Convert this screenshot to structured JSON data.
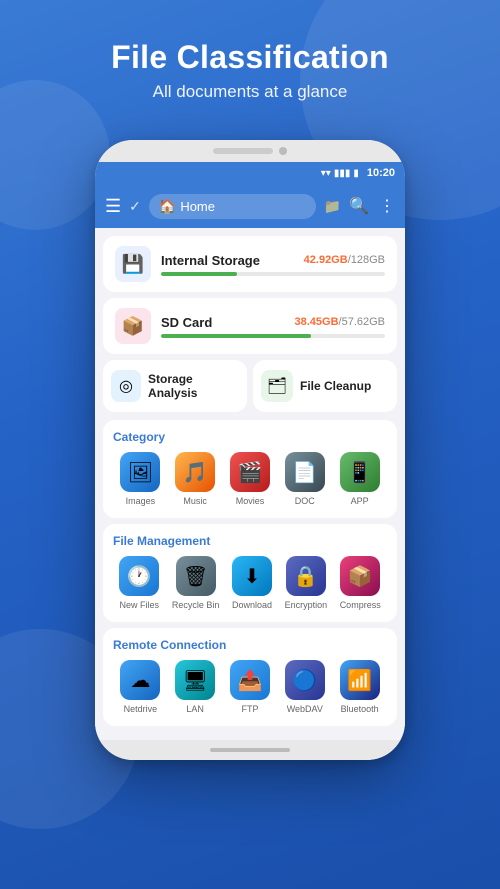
{
  "header": {
    "title": "File Classification",
    "subtitle": "All documents at a glance"
  },
  "phone": {
    "status_bar": {
      "time": "10:20"
    },
    "app_bar": {
      "home_label": "Home"
    },
    "storage": [
      {
        "name": "Internal Storage",
        "used": "42.92GB",
        "total": "128GB",
        "percent": 34,
        "icon": "💾",
        "icon_class": "storage-icon-internal"
      },
      {
        "name": "SD Card",
        "used": "38.45GB",
        "total": "57.62GB",
        "percent": 67,
        "icon": "📦",
        "icon_class": "storage-icon-sd"
      }
    ],
    "quick_actions": [
      {
        "label": "Storage Analysis",
        "icon": "◎",
        "icon_class": "qa-storage"
      },
      {
        "label": "File Cleanup",
        "icon": "🗂",
        "icon_class": "qa-cleanup"
      }
    ],
    "sections": [
      {
        "title": "Category",
        "items": [
          {
            "label": "Images",
            "icon": "🖼",
            "icon_class": "icon-images"
          },
          {
            "label": "Music",
            "icon": "🎵",
            "icon_class": "icon-music"
          },
          {
            "label": "Movies",
            "icon": "🎬",
            "icon_class": "icon-movies"
          },
          {
            "label": "DOC",
            "icon": "📄",
            "icon_class": "icon-doc"
          },
          {
            "label": "APP",
            "icon": "📱",
            "icon_class": "icon-app"
          }
        ]
      },
      {
        "title": "File Management",
        "items": [
          {
            "label": "New Files",
            "icon": "🕐",
            "icon_class": "icon-newfiles"
          },
          {
            "label": "Recycle Bin",
            "icon": "🗑",
            "icon_class": "icon-recyclebin"
          },
          {
            "label": "Download",
            "icon": "⬇",
            "icon_class": "icon-download"
          },
          {
            "label": "Encryption",
            "icon": "🔒",
            "icon_class": "icon-encryption"
          },
          {
            "label": "Compress",
            "icon": "📦",
            "icon_class": "icon-compress"
          }
        ]
      },
      {
        "title": "Remote Connection",
        "items": [
          {
            "label": "Netdrive",
            "icon": "☁",
            "icon_class": "icon-netdrive"
          },
          {
            "label": "LAN",
            "icon": "🖥",
            "icon_class": "icon-lan"
          },
          {
            "label": "FTP",
            "icon": "📤",
            "icon_class": "icon-ftp"
          },
          {
            "label": "WebDAV",
            "icon": "🔵",
            "icon_class": "icon-webdav"
          },
          {
            "label": "Bluetooth",
            "icon": "📶",
            "icon_class": "icon-bluetooth"
          }
        ]
      }
    ]
  }
}
